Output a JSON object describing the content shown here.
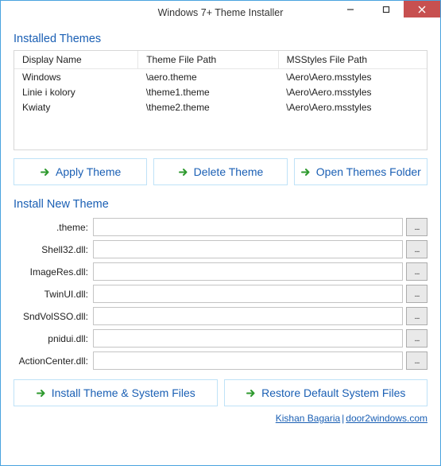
{
  "window": {
    "title": "Windows 7+ Theme Installer"
  },
  "sections": {
    "installed": "Installed Themes",
    "install_new": "Install New Theme"
  },
  "table": {
    "headers": {
      "display": "Display Name",
      "theme_path": "Theme File Path",
      "ms_path": "MSStyles File Path"
    },
    "rows": [
      {
        "display": "Windows",
        "theme_path": "\\aero.theme",
        "ms_path": "\\Aero\\Aero.msstyles"
      },
      {
        "display": "Linie i kolory",
        "theme_path": "\\theme1.theme",
        "ms_path": "\\Aero\\Aero.msstyles"
      },
      {
        "display": "Kwiaty",
        "theme_path": "\\theme2.theme",
        "ms_path": "\\Aero\\Aero.msstyles"
      }
    ]
  },
  "buttons": {
    "apply": "Apply Theme",
    "delete": "Delete Theme",
    "open_folder": "Open Themes Folder",
    "install": "Install Theme & System Files",
    "restore": "Restore Default System Files",
    "browse": "..."
  },
  "fields": {
    "theme": {
      "label": ".theme:",
      "value": ""
    },
    "shell32": {
      "label": "Shell32.dll:",
      "value": ""
    },
    "imageres": {
      "label": "ImageRes.dll:",
      "value": ""
    },
    "twinui": {
      "label": "TwinUI.dll:",
      "value": ""
    },
    "sndvolsso": {
      "label": "SndVolSSO.dll:",
      "value": ""
    },
    "pnidui": {
      "label": "pnidui.dll:",
      "value": ""
    },
    "actioncenter": {
      "label": "ActionCenter.dll:",
      "value": ""
    }
  },
  "footer": {
    "author": "Kishan Bagaria",
    "site": "door2windows.com",
    "sep": "|"
  }
}
